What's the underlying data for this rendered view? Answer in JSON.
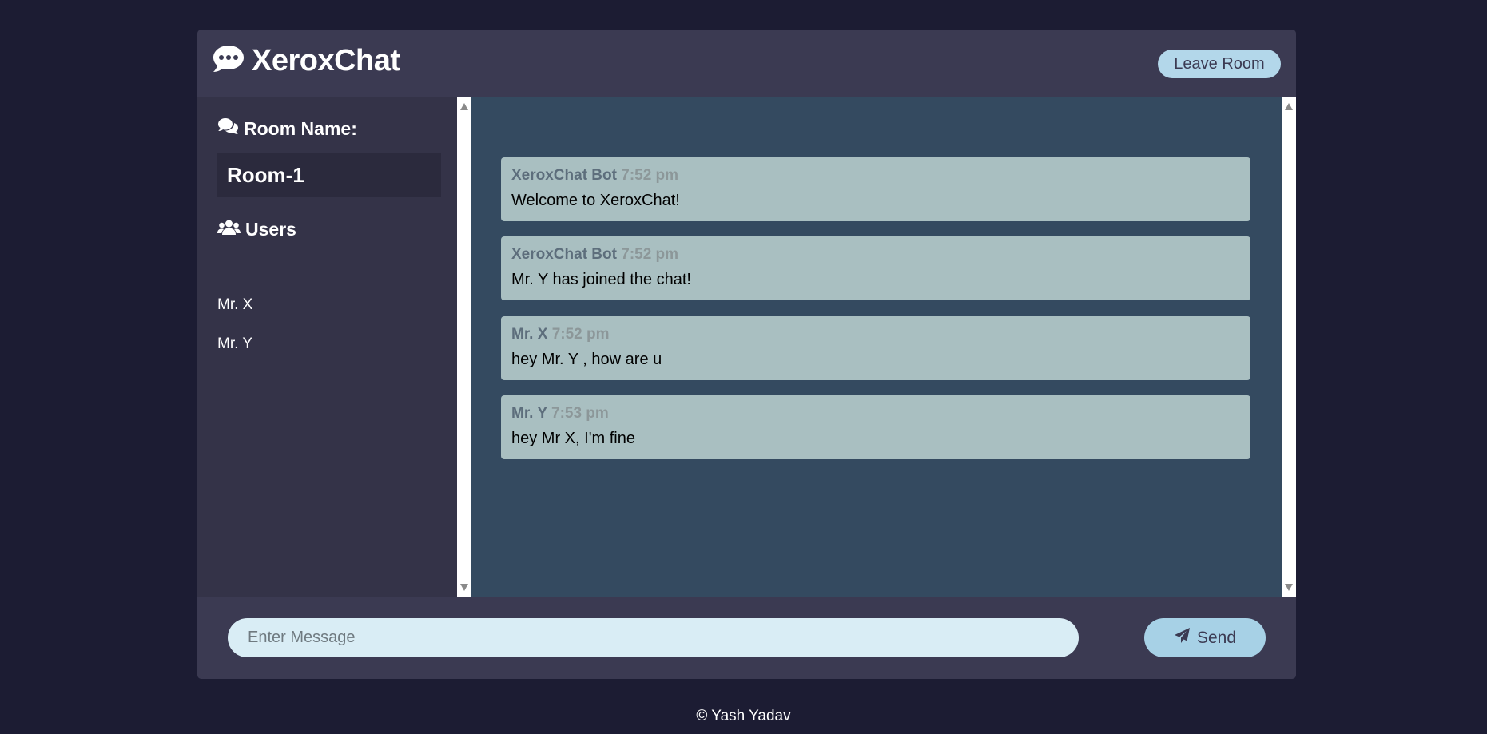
{
  "header": {
    "logo_icon": "comment-dots-icon",
    "title": "XeroxChat",
    "leave_label": "Leave Room"
  },
  "sidebar": {
    "room_heading_icon": "comments-icon",
    "room_heading": "Room Name:",
    "room_name": "Room-1",
    "users_heading_icon": "users-icon",
    "users_heading": "Users",
    "users": [
      "Mr. X",
      "Mr. Y"
    ]
  },
  "messages": [
    {
      "author": "XeroxChat Bot",
      "time": "7:52 pm",
      "text": "Welcome to XeroxChat!"
    },
    {
      "author": "XeroxChat Bot",
      "time": "7:52 pm",
      "text": "Mr. Y has joined the chat!"
    },
    {
      "author": "Mr. X",
      "time": "7:52 pm",
      "text": "hey Mr. Y , how are u"
    },
    {
      "author": "Mr. Y",
      "time": "7:53 pm",
      "text": "hey Mr X, I'm fine"
    }
  ],
  "composer": {
    "placeholder": "Enter Message",
    "value": "",
    "send_icon": "paper-plane-icon",
    "send_label": "Send"
  },
  "footer": {
    "copyright": "© Yash Yadav"
  },
  "colors": {
    "page_bg": "#1c1c33",
    "header_bg": "#3b3a52",
    "sidebar_bg": "#343348",
    "chat_bg": "#344a60",
    "message_bg": "#a9bfc1",
    "button_bg": "#b3d7ea"
  }
}
